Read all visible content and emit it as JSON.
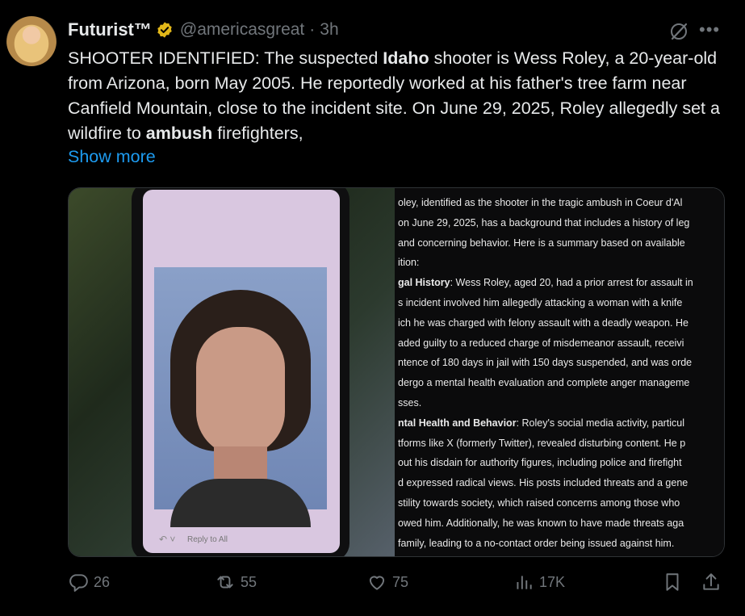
{
  "author": {
    "name": "Futurist™",
    "handle": "@americasgreat",
    "time": "3h"
  },
  "tweet_parts": [
    {
      "t": "SHOOTER IDENTIFIED: The suspected ",
      "b": false
    },
    {
      "t": "Idaho",
      "b": true
    },
    {
      "t": " shooter is Wess Roley, a 20-year-old from Arizona, born May 2005. He reportedly worked at his father's tree farm near Canfield Mountain, close to the incident site. On June 29, 2025, Roley allegedly set a wildfire to ",
      "b": false
    },
    {
      "t": "ambush",
      "b": true
    },
    {
      "t": " firefighters,",
      "b": false
    }
  ],
  "show_more": "Show more",
  "screenshot_text": {
    "reply_label": "Reply to All",
    "lines": [
      {
        "b": "",
        "t": "oley, identified as the shooter in the tragic ambush in Coeur d'Al"
      },
      {
        "b": "",
        "t": "on June 29, 2025, has a background that includes a history of leg"
      },
      {
        "b": "",
        "t": "and concerning behavior. Here is a summary based on available"
      },
      {
        "b": "",
        "t": "ition:"
      },
      {
        "b": "gal History",
        "t": ": Wess Roley, aged 20, had a prior arrest for assault in"
      },
      {
        "b": "",
        "t": "s incident involved him allegedly attacking a woman with a knife"
      },
      {
        "b": "",
        "t": "ich he was charged with felony assault with a deadly weapon. He"
      },
      {
        "b": "",
        "t": "aded guilty to a reduced charge of misdemeanor assault, receivi"
      },
      {
        "b": "",
        "t": "ntence of 180 days in jail with 150 days suspended, and was orde"
      },
      {
        "b": "",
        "t": "dergo a mental health evaluation and complete anger manageme"
      },
      {
        "b": "",
        "t": "sses."
      },
      {
        "b": "ntal Health and Behavior",
        "t": ": Roley's social media activity, particul"
      },
      {
        "b": "",
        "t": "tforms like X (formerly Twitter), revealed disturbing content. He p"
      },
      {
        "b": "",
        "t": "out his disdain for authority figures, including police and firefight"
      },
      {
        "b": "",
        "t": "d expressed radical views. His posts included threats and a gene"
      },
      {
        "b": "",
        "t": "stility towards society, which raised concerns among those who"
      },
      {
        "b": "",
        "t": "owed him. Additionally, he was known to have made threats aga"
      },
      {
        "b": "",
        "t": "family, leading to a no-contact order being issued against him."
      }
    ]
  },
  "stats": {
    "replies": "26",
    "reposts": "55",
    "likes": "75",
    "views": "17K"
  },
  "colors": {
    "background": "#000000",
    "text": "#e7e9ea",
    "muted": "#71767b",
    "link": "#1d9bf0",
    "verified": "#e2b719"
  },
  "icons": [
    "grok-icon",
    "more-icon",
    "verified-badge-icon",
    "reply-icon",
    "repost-icon",
    "like-icon",
    "views-icon",
    "bookmark-icon",
    "share-icon"
  ]
}
